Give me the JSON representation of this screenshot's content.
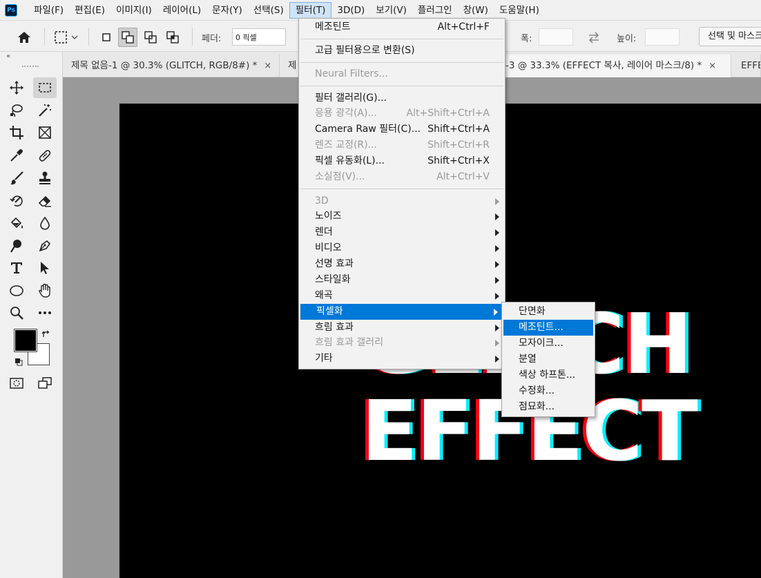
{
  "app": {
    "logo_text": "Ps"
  },
  "menubar": {
    "items": [
      "파일(F)",
      "편집(E)",
      "이미지(I)",
      "레이어(L)",
      "문자(Y)",
      "선택(S)",
      "필터(T)",
      "3D(D)",
      "보기(V)",
      "플러그인",
      "창(W)",
      "도움말(H)"
    ],
    "active_index": 6
  },
  "options_bar": {
    "feather_label": "페더:",
    "feather_value": "0 픽셀",
    "width_label": "폭:",
    "height_label": "높이:",
    "select_mask_button": "선택 및 마스크..."
  },
  "toolbar": {
    "collapse_glyph": "«",
    "foreground_color": "#000000",
    "background_color": "#ffffff"
  },
  "tabs": [
    {
      "label": "제목 없음-1 @ 30.3% (GLITCH, RGB/8#) *",
      "close": "×"
    },
    {
      "label": "제",
      "close": ""
    },
    {
      "label": "-3 @ 33.3% (EFFECT 복사, 레이어 마스크/8) *",
      "close": "×"
    },
    {
      "label": "EFFE",
      "close": ""
    }
  ],
  "canvas": {
    "text_line1": "GLITCH",
    "text_line2": "EFFECT"
  },
  "filter_menu": {
    "items": [
      {
        "label": "메조틴트",
        "shortcut": "Alt+Ctrl+F",
        "disabled": false
      },
      {
        "label": "고급 필터용으로 변환(S)",
        "shortcut": "",
        "disabled": false
      },
      {
        "label": "Neural Filters...",
        "shortcut": "",
        "disabled": true
      },
      {
        "label": "필터 갤러리(G)...",
        "shortcut": "",
        "disabled": false
      },
      {
        "label": "응용 광각(A)...",
        "shortcut": "Alt+Shift+Ctrl+A",
        "disabled": true
      },
      {
        "label": "Camera Raw 필터(C)...",
        "shortcut": "Shift+Ctrl+A",
        "disabled": false
      },
      {
        "label": "렌즈 교정(R)...",
        "shortcut": "Shift+Ctrl+R",
        "disabled": true
      },
      {
        "label": "픽셀 유동화(L)...",
        "shortcut": "Shift+Ctrl+X",
        "disabled": false
      },
      {
        "label": "소실점(V)...",
        "shortcut": "Alt+Ctrl+V",
        "disabled": true
      },
      {
        "label": "3D",
        "shortcut": "",
        "disabled": true
      },
      {
        "label": "노이즈",
        "shortcut": "",
        "disabled": false
      },
      {
        "label": "렌더",
        "shortcut": "",
        "disabled": false
      },
      {
        "label": "비디오",
        "shortcut": "",
        "disabled": false
      },
      {
        "label": "선명 효과",
        "shortcut": "",
        "disabled": false
      },
      {
        "label": "스타일화",
        "shortcut": "",
        "disabled": false
      },
      {
        "label": "왜곡",
        "shortcut": "",
        "disabled": false
      },
      {
        "label": "픽셀화",
        "shortcut": "",
        "disabled": false
      },
      {
        "label": "흐림 효과",
        "shortcut": "",
        "disabled": false
      },
      {
        "label": "흐림 효과 갤러리",
        "shortcut": "",
        "disabled": true
      },
      {
        "label": "기타",
        "shortcut": "",
        "disabled": false
      }
    ]
  },
  "pixelate_submenu": {
    "items": [
      "단면화",
      "메조틴트...",
      "모자이크...",
      "분열",
      "색상 하프톤...",
      "수정화...",
      "점묘화..."
    ],
    "highlighted_index": 1
  }
}
